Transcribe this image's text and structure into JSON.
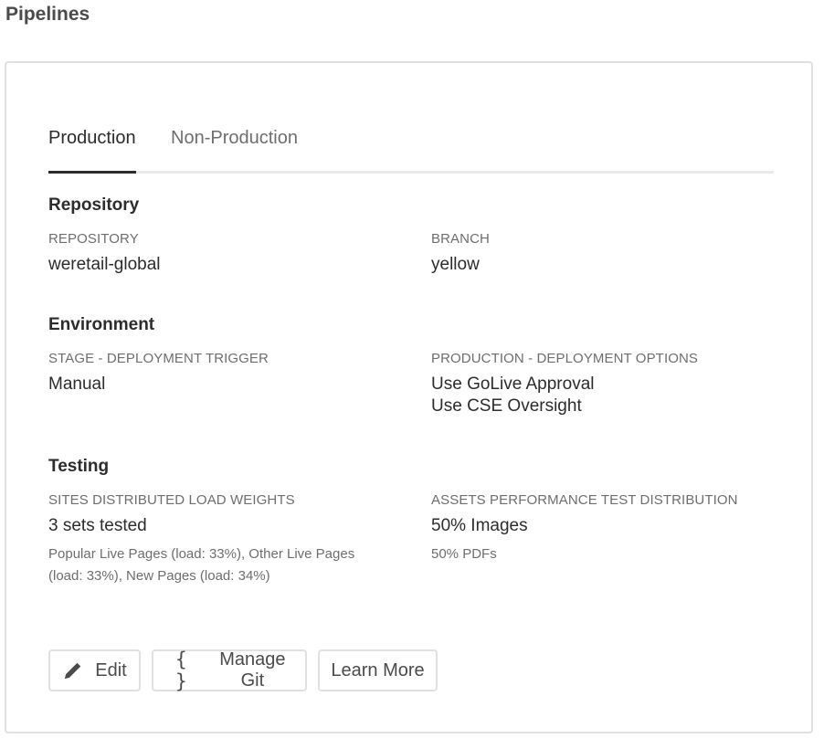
{
  "page": {
    "title": "Pipelines"
  },
  "tabs": [
    {
      "label": "Production",
      "active": true
    },
    {
      "label": "Non-Production",
      "active": false
    }
  ],
  "repository": {
    "heading": "Repository",
    "repo_label": "REPOSITORY",
    "repo_value": "weretail-global",
    "branch_label": "BRANCH",
    "branch_value": "yellow"
  },
  "environment": {
    "heading": "Environment",
    "stage_label": "STAGE - DEPLOYMENT TRIGGER",
    "stage_value": "Manual",
    "prod_label": "PRODUCTION - DEPLOYMENT OPTIONS",
    "prod_options": [
      "Use GoLive Approval",
      "Use CSE Oversight"
    ]
  },
  "testing": {
    "heading": "Testing",
    "sites_label": "SITES DISTRIBUTED LOAD WEIGHTS",
    "sites_value": "3 sets tested",
    "sites_detail": [
      "Popular Live Pages (load: 33%), Other Live Pages",
      "(load: 33%), New Pages (load: 34%)"
    ],
    "assets_label": "ASSETS PERFORMANCE TEST DISTRIBUTION",
    "assets_value": "50% Images",
    "assets_detail": "50% PDFs"
  },
  "actions": {
    "edit_label": "Edit",
    "manage_git_label": "Manage Git",
    "learn_more_label": "Learn More"
  },
  "icons": {
    "edit": "pencil-icon",
    "manage_git": "braces-icon"
  },
  "colors": {
    "text": "#2c2c2c",
    "muted": "#6e6e6e",
    "border": "#e1e1e1"
  }
}
